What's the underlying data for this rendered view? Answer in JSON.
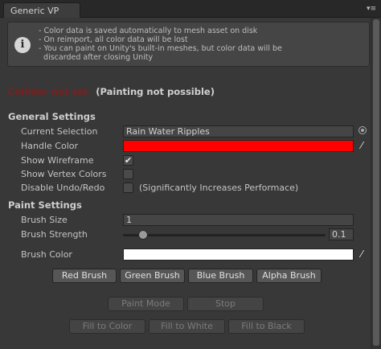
{
  "tab": {
    "title": "Generic VP"
  },
  "help": {
    "lines": [
      "- Color data is saved automatically to mesh asset on disk",
      "- On reimport, all color data will be lost",
      "- You can paint on Unity's built-in meshes, but color data will be",
      "  discarded after closing Unity"
    ]
  },
  "status": {
    "error": "Collider not set",
    "message": "(Painting not possible)"
  },
  "general": {
    "heading": "General Settings",
    "current_selection_label": "Current Selection",
    "current_selection_value": "Rain Water Ripples",
    "handle_color_label": "Handle Color",
    "handle_color": "#ff0000",
    "show_wireframe_label": "Show Wireframe",
    "show_wireframe_checked": true,
    "show_vertex_colors_label": "Show Vertex Colors",
    "show_vertex_colors_checked": false,
    "disable_undo_label": "Disable Undo/Redo",
    "disable_undo_checked": false,
    "disable_undo_note": "(Significantly Increases Performace)"
  },
  "paint": {
    "heading": "Paint Settings",
    "brush_size_label": "Brush Size",
    "brush_size_value": "1",
    "brush_strength_label": "Brush Strength",
    "brush_strength_value": "0.1",
    "brush_strength_fraction": 0.1,
    "brush_color_label": "Brush Color",
    "brush_color": "#ffffff"
  },
  "buttons": {
    "red_brush": "Red Brush",
    "green_brush": "Green Brush",
    "blue_brush": "Blue Brush",
    "alpha_brush": "Alpha Brush",
    "paint_mode": "Paint Mode",
    "stop": "Stop",
    "fill_color": "Fill to Color",
    "fill_white": "Fill to White",
    "fill_black": "Fill to Black"
  },
  "icons": {
    "info": "info-icon",
    "menu": "context-menu-icon",
    "picker": "eyedropper-icon",
    "target": "object-picker-icon"
  }
}
